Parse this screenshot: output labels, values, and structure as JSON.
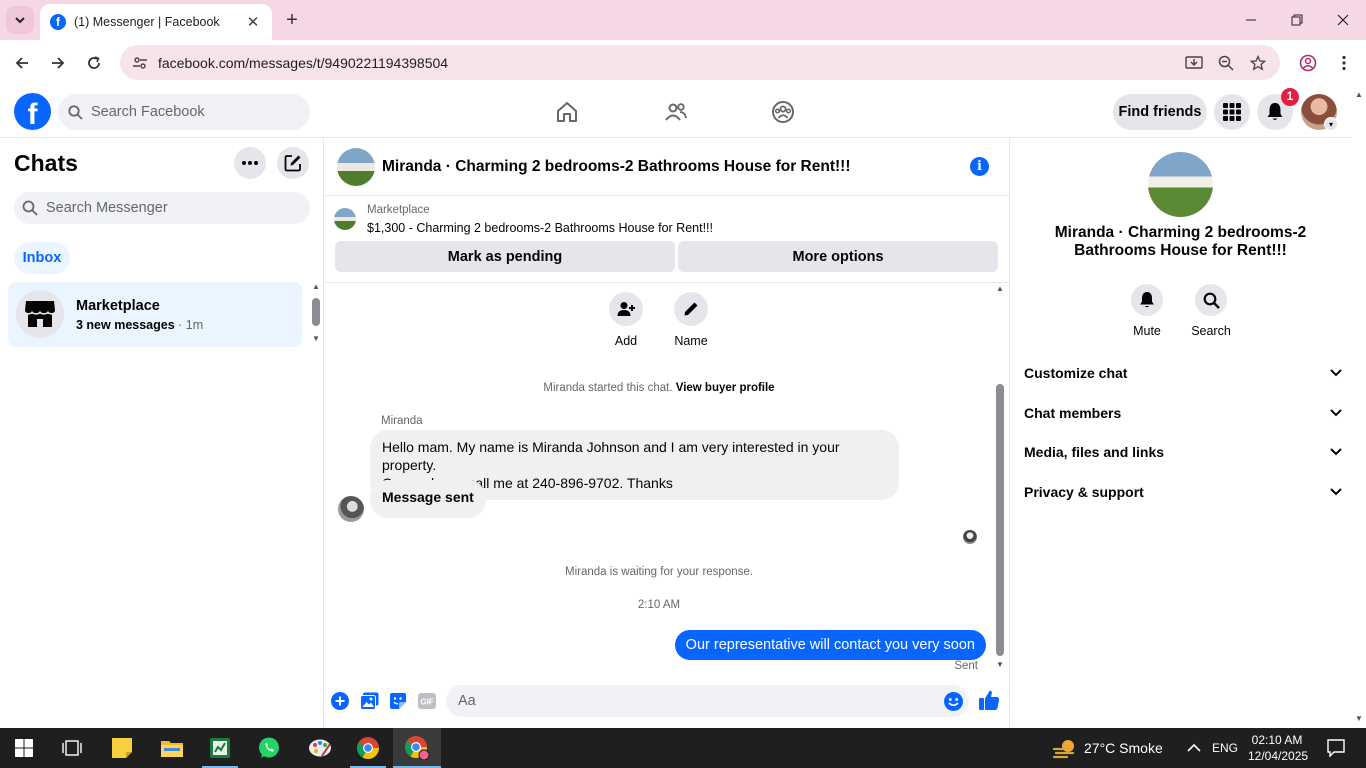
{
  "browser": {
    "tab_title": "(1) Messenger | Facebook",
    "url": "facebook.com/messages/t/9490221194398504",
    "new_tab_label": "+"
  },
  "fb_header": {
    "search_placeholder": "Search Facebook",
    "find_friends_label": "Find friends",
    "notification_count": "1"
  },
  "sidebar": {
    "title": "Chats",
    "search_placeholder": "Search Messenger",
    "filter_label": "Inbox",
    "conversations": [
      {
        "name": "Marketplace",
        "preview": "3 new messages",
        "time": "· 1m"
      }
    ]
  },
  "conversation": {
    "title": "Miranda · Charming 2 bedrooms-2 Bathrooms House for Rent!!!",
    "marketplace_label": "Marketplace",
    "listing": "$1,300 - Charming 2 bedrooms-2 Bathrooms House for Rent!!!",
    "mark_pending_label": "Mark as pending",
    "more_options_label": "More options",
    "actions": [
      {
        "label": "Add",
        "icon": "add-person-icon"
      },
      {
        "label": "Name",
        "icon": "pencil-icon"
      }
    ],
    "started_text": "Miranda started this chat.",
    "view_profile_label": "View buyer profile",
    "sender_name": "Miranda",
    "messages_in": [
      {
        "line1": "Hello mam.  My name is Miranda Johnson and I am very interested in your property.",
        "line2": "Can u please call me at 240-896-9702.  Thanks"
      },
      {
        "line1": "Message sent",
        "line2": ""
      }
    ],
    "waiting_text": "Miranda is waiting for your response.",
    "timestamp": "2:10 AM",
    "message_out": "Our representative will contact you very soon",
    "sent_label": "Sent",
    "composer_placeholder": "Aa"
  },
  "details": {
    "title": "Miranda · Charming 2 bedrooms-2 Bathrooms House for Rent!!!",
    "actions": [
      {
        "label": "Mute",
        "icon": "bell-icon"
      },
      {
        "label": "Search",
        "icon": "search-icon"
      }
    ],
    "sections": [
      "Customize chat",
      "Chat members",
      "Media, files and links",
      "Privacy & support"
    ]
  },
  "taskbar": {
    "weather": "27°C  Smoke",
    "language": "ENG",
    "time": "02:10 AM",
    "date": "12/04/2025"
  },
  "colors": {
    "accent": "#0866ff",
    "tabbar": "#f6d7e6",
    "badge": "#e41e3f"
  }
}
